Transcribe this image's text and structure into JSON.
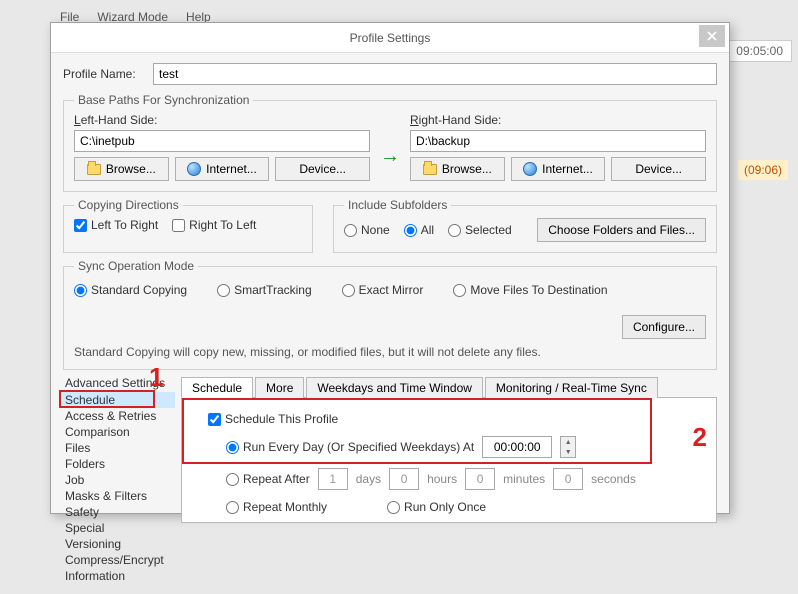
{
  "bg_menu": {
    "file": "File",
    "wizard": "Wizard Mode",
    "help": "Help"
  },
  "bg_time": "09:05:00",
  "bg_hl": "(09:06)",
  "dialog": {
    "title": "Profile Settings",
    "profile_name_lbl": "Profile Name:",
    "profile_name_val": "test"
  },
  "paths": {
    "legend": "Base Paths For Synchronization",
    "left_lbl": "Left-Hand Side:",
    "right_lbl": "Right-Hand Side:",
    "left_val": "C:\\inetpub",
    "right_val": "D:\\backup",
    "browse": "Browse...",
    "internet": "Internet...",
    "device": "Device..."
  },
  "copy": {
    "legend": "Copying Directions",
    "ltr": "Left To Right",
    "rtl": "Right To Left"
  },
  "incl": {
    "legend": "Include Subfolders",
    "none": "None",
    "all": "All",
    "sel": "Selected",
    "choose": "Choose Folders and Files..."
  },
  "sync": {
    "legend": "Sync Operation Mode",
    "std": "Standard Copying",
    "smart": "SmartTracking",
    "exact": "Exact Mirror",
    "move": "Move Files To Destination",
    "configure": "Configure...",
    "note": "Standard Copying will copy new, missing, or modified files, but it will not delete any files."
  },
  "tree": {
    "head": "Advanced Settings",
    "items": [
      "Schedule",
      "Access & Retries",
      "Comparison",
      "Files",
      "Folders",
      "Job",
      "Masks & Filters",
      "Safety",
      "Special",
      "Versioning",
      "Compress/Encrypt",
      "Information"
    ]
  },
  "tabs": {
    "t1": "Schedule",
    "t2": "More",
    "t3": "Weekdays and Time Window",
    "t4": "Monitoring / Real-Time Sync"
  },
  "sched": {
    "enable": "Schedule This Profile",
    "every": "Run Every Day (Or Specified Weekdays) At",
    "time": "00:00:00",
    "repeat_after": "Repeat After",
    "days": "days",
    "hours": "hours",
    "minutes": "minutes",
    "seconds": "seconds",
    "v_days": "1",
    "v_hours": "0",
    "v_minutes": "0",
    "v_seconds": "0",
    "repeat_monthly": "Repeat Monthly",
    "run_once": "Run Only Once"
  },
  "anno": {
    "n1": "1",
    "n2": "2"
  }
}
